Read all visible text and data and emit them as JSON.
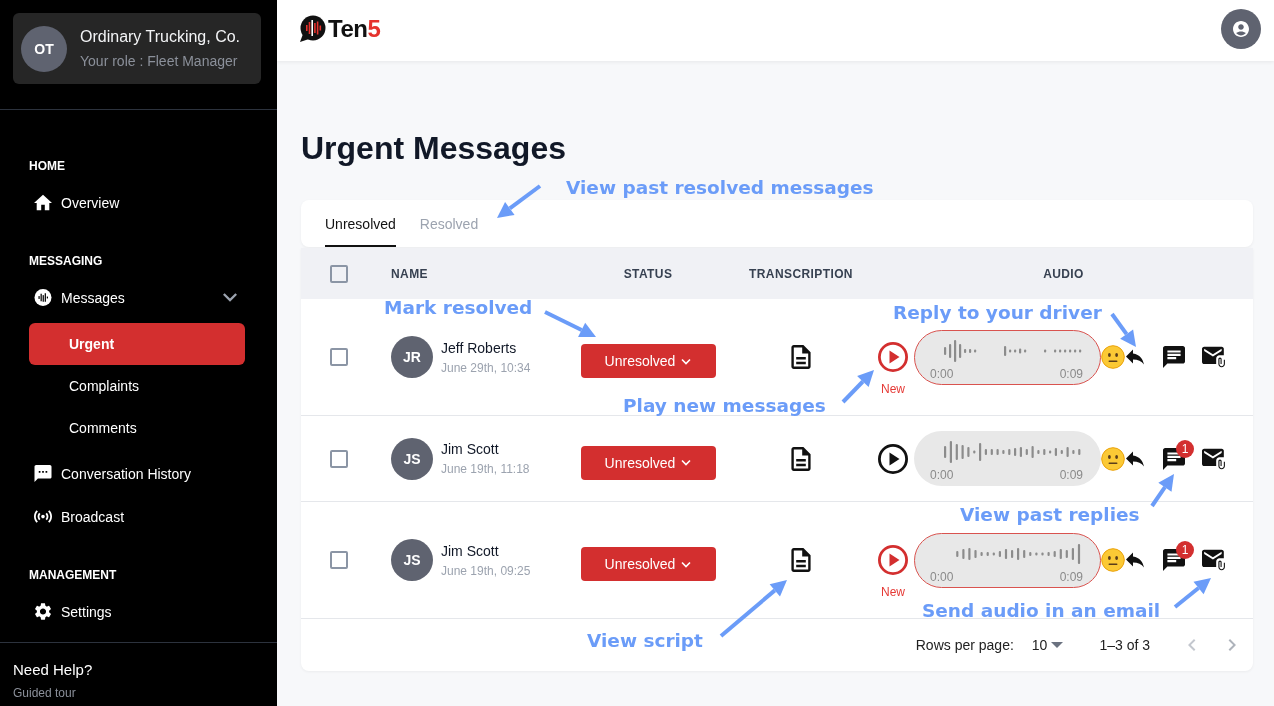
{
  "sidebar": {
    "organization": {
      "initials": "OT",
      "name": "Ordinary Trucking, Co.",
      "role": "Your role : Fleet Manager"
    },
    "sections": [
      {
        "heading": "HOME",
        "items": [
          {
            "label": "Overview",
            "selected": false
          }
        ]
      },
      {
        "heading": "MESSAGING",
        "items": [
          {
            "label": "Messages",
            "selected": false,
            "expanded": true,
            "children": [
              {
                "label": "Urgent",
                "selected": true
              },
              {
                "label": "Complaints",
                "selected": false
              },
              {
                "label": "Comments",
                "selected": false
              }
            ]
          },
          {
            "label": "Conversation History",
            "selected": false
          },
          {
            "label": "Broadcast",
            "selected": false
          }
        ]
      },
      {
        "heading": "MANAGEMENT",
        "items": [
          {
            "label": "Settings",
            "selected": false
          }
        ]
      }
    ],
    "help": {
      "title": "Need Help?",
      "link": "Guided tour"
    }
  },
  "header": {
    "logo": {
      "name": "Ten",
      "accent": "5"
    }
  },
  "page_title": "Urgent Messages",
  "tabs": [
    {
      "label": "Unresolved",
      "selected": true
    },
    {
      "label": "Resolved",
      "selected": false
    }
  ],
  "table": {
    "select_all_checked": false,
    "columns": [
      "NAME",
      "STATUS",
      "TRANSCRIPTION",
      "AUDIO"
    ],
    "rows": [
      {
        "checked": false,
        "initials": "JR",
        "name": "Jeff Roberts",
        "time": "June 29th, 10:34",
        "status": "Unresolved",
        "audio": {
          "new": true,
          "new_label": "New",
          "start": "0:00",
          "end": "0:09"
        }
      },
      {
        "checked": false,
        "initials": "JS",
        "name": "Jim Scott",
        "time": "June 19th, 11:18",
        "status": "Unresolved",
        "audio": {
          "new": false,
          "start": "0:00",
          "end": "0:09"
        },
        "reply_count": "1"
      },
      {
        "checked": false,
        "initials": "JS",
        "name": "Jim Scott",
        "time": "June 19th, 09:25",
        "status": "Unresolved",
        "audio": {
          "new": true,
          "new_label": "New",
          "start": "0:00",
          "end": "0:09"
        },
        "reply_count": "1"
      }
    ],
    "pagination": {
      "rows_per_page_label": "Rows per page:",
      "rows_per_page": "10",
      "range": "1–3 of 3",
      "previous_disabled": true,
      "next_disabled": true
    }
  },
  "annotations": [
    "View past resolved messages",
    "Mark resolved",
    "Reply to your driver",
    "Play new messages",
    "View past replies",
    "Send audio in an email",
    "View script"
  ]
}
